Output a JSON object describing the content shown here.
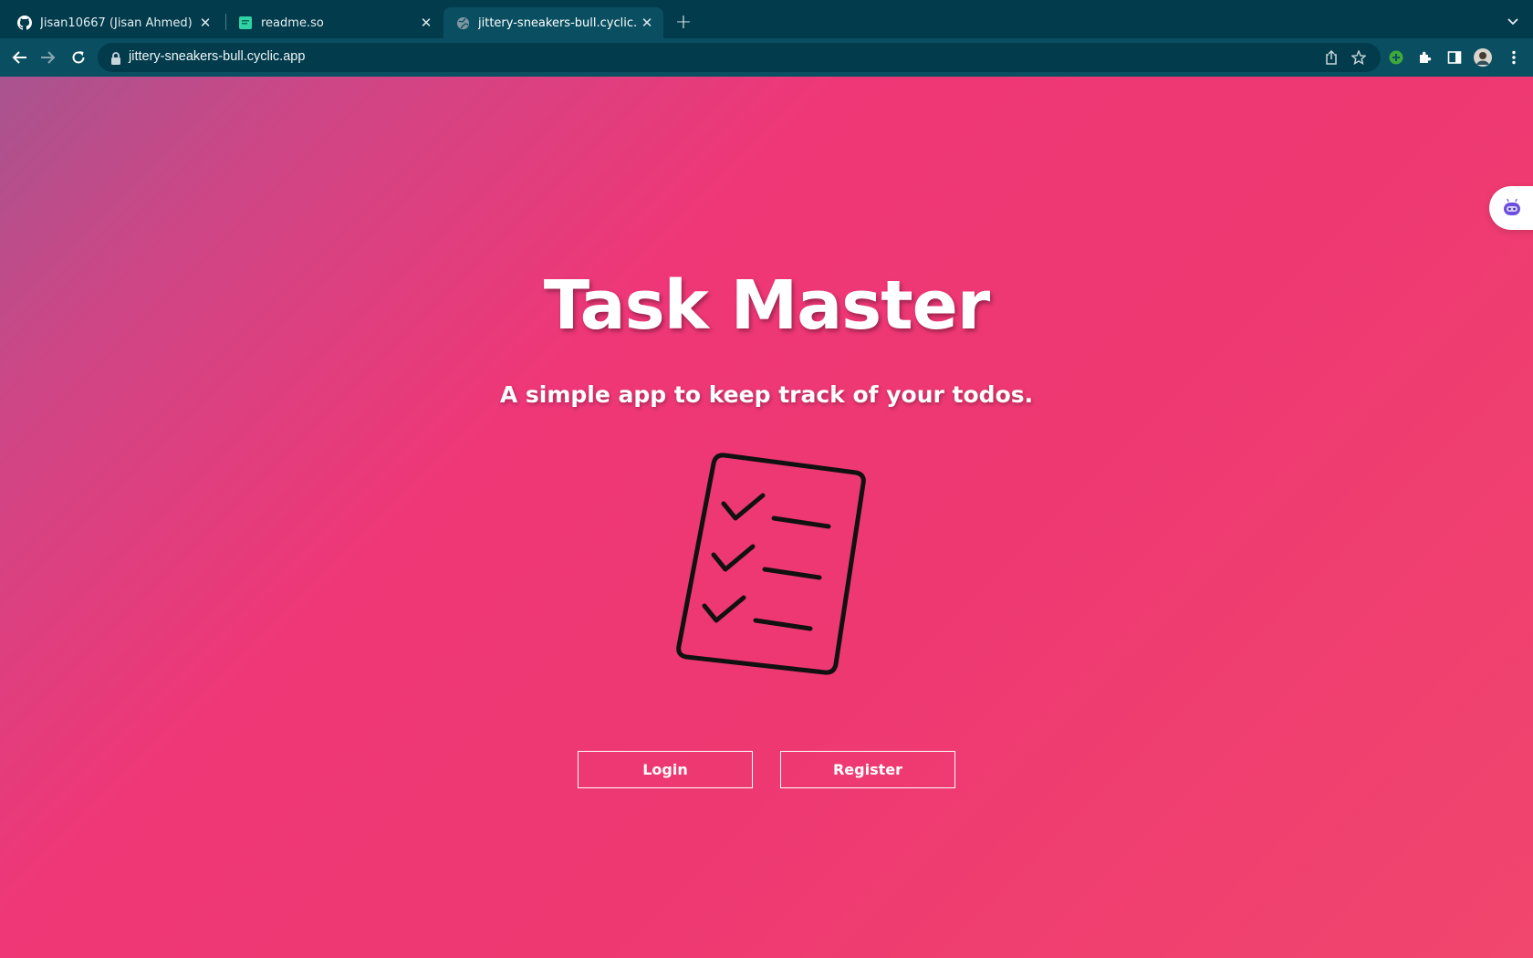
{
  "browser": {
    "tabs": [
      {
        "label": "Jisan10667 (Jisan Ahmed)",
        "favicon": "github-icon"
      },
      {
        "label": "readme.so",
        "favicon": "readme-so-icon"
      },
      {
        "label": "jittery-sneakers-bull.cyclic.app",
        "favicon": "globe-icon",
        "active": true
      }
    ],
    "url": "jittery-sneakers-bull.cyclic.app",
    "accent": "#023b4c"
  },
  "page": {
    "title": "Task Master",
    "subtitle": "A simple app to keep track of your todos.",
    "login_label": "Login",
    "register_label": "Register",
    "illustration": "checklist-clipboard-icon",
    "gradient": [
      "#a8548f",
      "#ef3777",
      "#f1466d"
    ]
  }
}
